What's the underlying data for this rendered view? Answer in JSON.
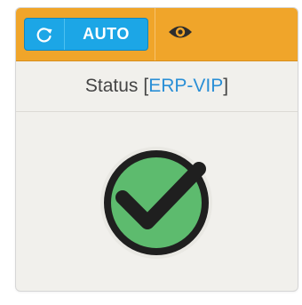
{
  "header": {
    "auto_button": {
      "label": "AUTO",
      "icon": "refresh-icon"
    },
    "eye_button": {
      "icon": "eye-icon"
    },
    "colors": {
      "header_bg": "#f0a52a",
      "auto_button_bg": "#1ca6e6"
    }
  },
  "status": {
    "label": "Status",
    "bracket_open": "[",
    "code": "ERP-VIP",
    "bracket_close": "]",
    "code_color": "#2a8fd6"
  },
  "indicator": {
    "icon": "check-circle-icon",
    "state": "ok",
    "color": "#5dbb6e"
  }
}
